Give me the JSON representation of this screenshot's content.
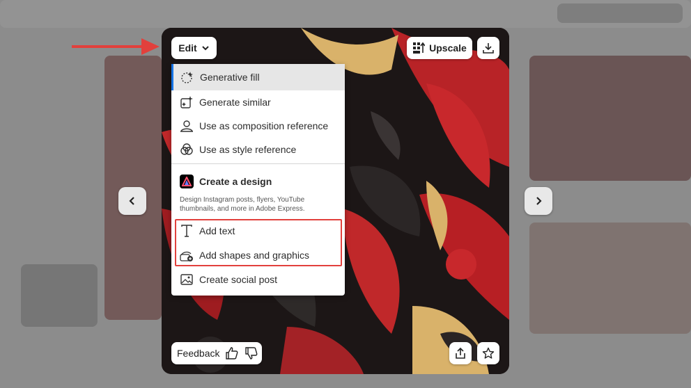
{
  "toolbar": {
    "edit_label": "Edit",
    "upscale_label": "Upscale"
  },
  "menu": {
    "items": [
      {
        "label": "Generative fill",
        "icon": "generative-fill-icon",
        "active": true
      },
      {
        "label": "Generate similar",
        "icon": "generate-similar-icon"
      },
      {
        "label": "Use as composition reference",
        "icon": "composition-reference-icon"
      },
      {
        "label": "Use as style reference",
        "icon": "style-reference-icon"
      }
    ],
    "design_section": {
      "title": "Create a design",
      "description": "Design Instagram posts, flyers, YouTube thumbnails, and more in Adobe Express."
    },
    "express_items": [
      {
        "label": "Add text",
        "icon": "text-icon"
      },
      {
        "label": "Add shapes and graphics",
        "icon": "shapes-icon"
      },
      {
        "label": "Create social post",
        "icon": "image-icon"
      }
    ]
  },
  "footer": {
    "feedback_label": "Feedback"
  },
  "colors": {
    "accent": "#1473e6",
    "annotation": "#e2403c",
    "art_red": "#c0282a",
    "art_gold": "#d9b26a",
    "art_black": "#1c1616"
  }
}
